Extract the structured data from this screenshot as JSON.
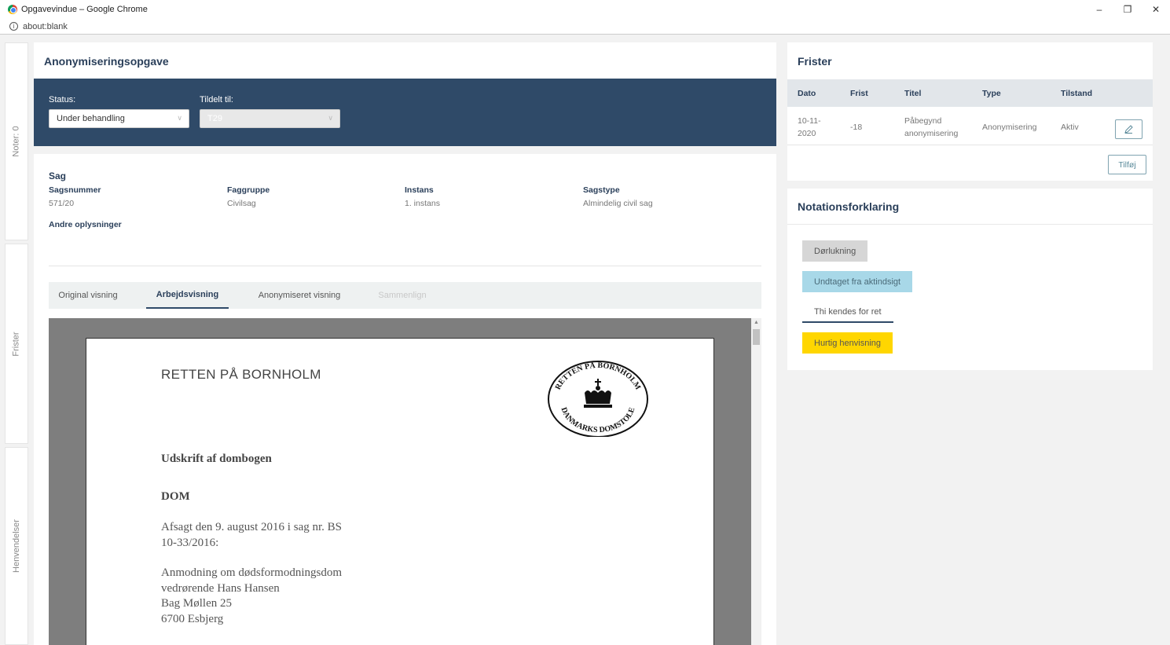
{
  "browser": {
    "window_title": "Opgavevindue – Google Chrome",
    "url": "about:blank",
    "controls": [
      "–",
      "❐",
      "✕"
    ]
  },
  "sidebar": {
    "tabs": [
      {
        "label": "Noter: 0"
      },
      {
        "label": "Frister"
      },
      {
        "label": "Henvendelser"
      }
    ]
  },
  "task": {
    "title": "Anonymiseringsopgave",
    "status_label": "Status:",
    "status_value": "Under behandling",
    "assigned_label": "Tildelt til:",
    "assigned_value": "T29"
  },
  "case": {
    "title": "Sag",
    "fields": [
      {
        "label": "Sagsnummer",
        "value": "571/20"
      },
      {
        "label": "Faggruppe",
        "value": "Civilsag"
      },
      {
        "label": "Instans",
        "value": "1. instans"
      },
      {
        "label": "Sagstype",
        "value": "Almindelig civil sag"
      }
    ],
    "other_info_label": "Andre oplysninger"
  },
  "views": {
    "tabs": [
      {
        "label": "Original visning",
        "state": "normal"
      },
      {
        "label": "Arbejdsvisning",
        "state": "active"
      },
      {
        "label": "Anonymiseret visning",
        "state": "normal"
      },
      {
        "label": "Sammenlign",
        "state": "disabled"
      }
    ]
  },
  "document": {
    "court": "RETTEN PÅ BORNHOLM",
    "seal_top": "RETTEN PÅ BORNHOLM",
    "seal_bottom": "DANMARKS DOMSTOLE",
    "heading1": "Udskrift af dombogen",
    "heading2": "DOM",
    "para1_line1": "Afsagt den 9. august 2016 i sag nr. BS",
    "para1_line2": "10-33/2016:",
    "para2_line1": "Anmodning om dødsformodningsdom",
    "para2_line2": "vedrørende Hans Hansen",
    "para2_line3": "Bag Møllen 25",
    "para2_line4": "6700 Esbjerg"
  },
  "deadlines": {
    "title": "Frister",
    "columns": [
      "Dato",
      "Frist",
      "Titel",
      "Type",
      "Tilstand"
    ],
    "rows": [
      {
        "date_line1": "10-11-",
        "date_line2": "2020",
        "frist": "-18",
        "title_line1": "Påbegynd",
        "title_line2": "anonymisering",
        "type": "Anonymisering",
        "state": "Aktiv"
      }
    ],
    "add_label": "Tilføj"
  },
  "notation": {
    "title": "Notationsforklaring",
    "items": [
      {
        "label": "Dørlukning",
        "color": "#d6d6d6"
      },
      {
        "label": "Undtaget fra aktindsigt",
        "color": "#a8d8e8"
      },
      {
        "label": "Thi kendes for ret",
        "color": "#ffffff"
      },
      {
        "label": "Hurtig henvisning",
        "color": "#ffd600"
      }
    ]
  }
}
